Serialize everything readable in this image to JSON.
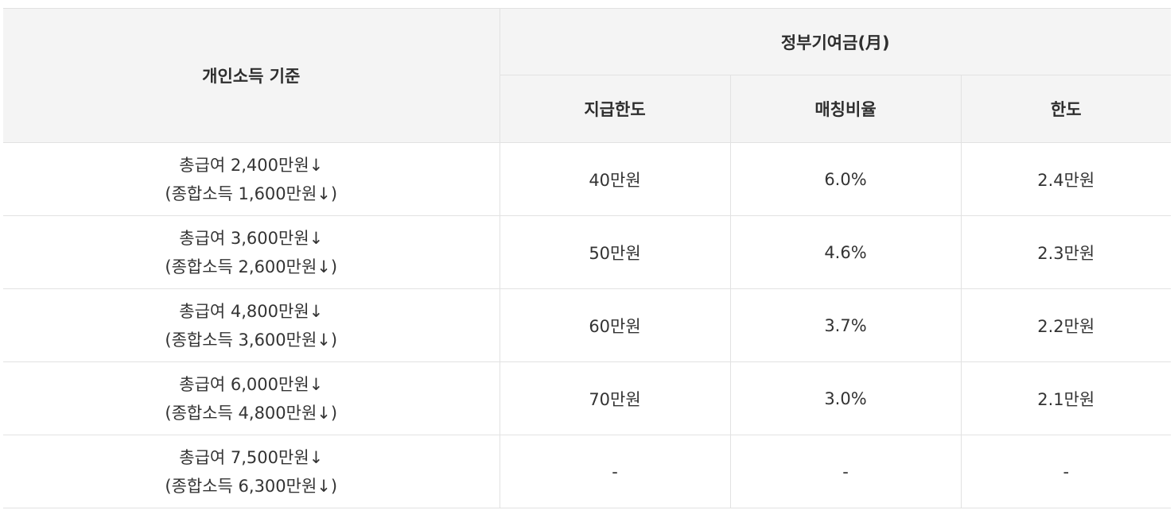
{
  "table": {
    "header": {
      "income_basis": "개인소득 기준",
      "gov_contribution": "정부기여금(月)",
      "sub": {
        "payment_limit": "지급한도",
        "matching_ratio": "매칭비율",
        "limit": "한도"
      }
    },
    "rows": [
      {
        "income_line1": "총급여 2,400만원↓",
        "income_line2": "(종합소득 1,600만원↓)",
        "payment_limit": "40만원",
        "matching_ratio": "6.0%",
        "limit": "2.4만원"
      },
      {
        "income_line1": "총급여 3,600만원↓",
        "income_line2": "(종합소득 2,600만원↓)",
        "payment_limit": "50만원",
        "matching_ratio": "4.6%",
        "limit": "2.3만원"
      },
      {
        "income_line1": "총급여 4,800만원↓",
        "income_line2": "(종합소득 3,600만원↓)",
        "payment_limit": "60만원",
        "matching_ratio": "3.7%",
        "limit": "2.2만원"
      },
      {
        "income_line1": "총급여 6,000만원↓",
        "income_line2": "(종합소득 4,800만원↓)",
        "payment_limit": "70만원",
        "matching_ratio": "3.0%",
        "limit": "2.1만원"
      },
      {
        "income_line1": "총급여 7,500만원↓",
        "income_line2": "(종합소득 6,300만원↓)",
        "payment_limit": "-",
        "matching_ratio": "-",
        "limit": "-"
      }
    ]
  }
}
